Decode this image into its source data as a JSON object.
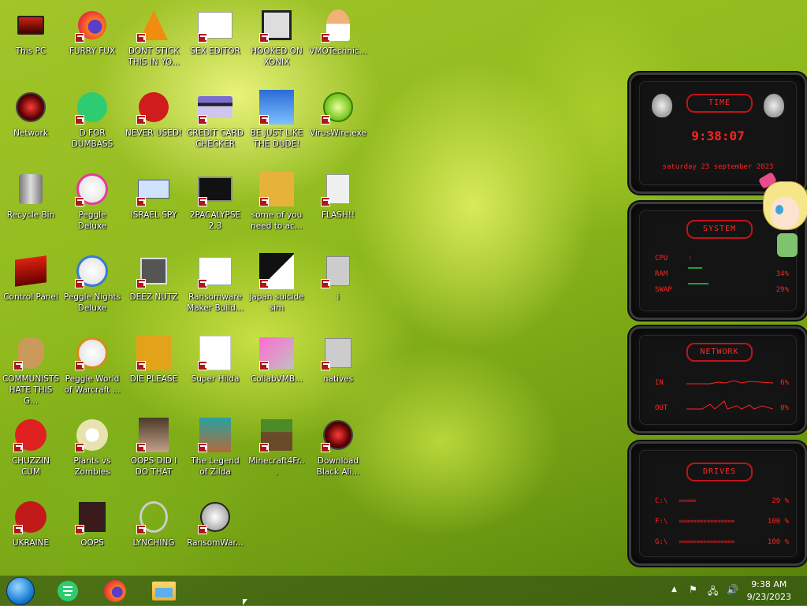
{
  "desktop_icons": [
    {
      "label": "This PC",
      "icon": "monitor-icon"
    },
    {
      "label": "FURRY FUX",
      "icon": "firefox-icon"
    },
    {
      "label": "DONT STICK THIS IN YO...",
      "icon": "vlc-cone-icon"
    },
    {
      "label": "SEX EDITOR",
      "icon": "hex-editor-icon"
    },
    {
      "label": "HOOKED ON XONIX",
      "icon": "xonix-icon"
    },
    {
      "label": "VMOTechnic...",
      "icon": "doctor-icon"
    },
    {
      "label": "Network",
      "icon": "red-orb-icon"
    },
    {
      "label": "D FOR DUMBASS",
      "icon": "green-chat-icon"
    },
    {
      "label": "NEVER USED!",
      "icon": "devcpp-icon"
    },
    {
      "label": "CREDIT CARD CHECKER",
      "icon": "credit-card-icon"
    },
    {
      "label": "BE JUST LIKE THE DUDE!",
      "icon": "santa-icon"
    },
    {
      "label": "VirusWire.exe",
      "icon": "lime-icon"
    },
    {
      "label": "Recycle Bin",
      "icon": "recycle-bin-icon"
    },
    {
      "label": "Peggle Deluxe",
      "icon": "peggle-icon"
    },
    {
      "label": "ISRAEL SPY",
      "icon": "network-spy-icon"
    },
    {
      "label": "2PACALYPSE 2.3",
      "icon": "terminal-icon"
    },
    {
      "label": "some of you need to ac...",
      "icon": "dog-icon"
    },
    {
      "label": "FLASH!!",
      "icon": "flash-icon"
    },
    {
      "label": "Control Panel",
      "icon": "control-panel-icon"
    },
    {
      "label": "Peggle Nights Deluxe",
      "icon": "peggle-nights-icon"
    },
    {
      "label": "DEEZ NUTZ",
      "icon": "stack-windows-icon"
    },
    {
      "label": "Ransomware Maker Build...",
      "icon": "ransomware-maker-icon"
    },
    {
      "label": "japan suicide sim",
      "icon": "japan-sim-icon"
    },
    {
      "label": "i",
      "icon": "app-i-icon"
    },
    {
      "label": "COMMUNISTS HATE THIS G...",
      "icon": "money-bag-icon"
    },
    {
      "label": "Peggle World of Warcraft ...",
      "icon": "peggle-wow-icon"
    },
    {
      "label": "DIE PLEASE",
      "icon": "de-icon"
    },
    {
      "label": "Super Hilda",
      "icon": "pixel-cat-icon"
    },
    {
      "label": "CollabVMB...",
      "icon": "collabvm-icon"
    },
    {
      "label": "natives",
      "icon": "natives-icon"
    },
    {
      "label": "CHUZZIN CUM",
      "icon": "chuzzle-icon"
    },
    {
      "label": "Plants vs Zombies",
      "icon": "pvz-icon"
    },
    {
      "label": "OOPS DID I DO THAT",
      "icon": "portrait-icon"
    },
    {
      "label": "The Legend of Zilda",
      "icon": "zilda-icon"
    },
    {
      "label": "Minecraft4Fr...",
      "icon": "minecraft-icon"
    },
    {
      "label": "Download Black Ali...",
      "icon": "red-orb-icon"
    },
    {
      "label": "UKRAINE",
      "icon": "radiation-icon"
    },
    {
      "label": "OOPS",
      "icon": "oops-icon"
    },
    {
      "label": "LYNCHING",
      "icon": "noose-icon"
    },
    {
      "label": "RansomWar...",
      "icon": "skull-icon"
    }
  ],
  "widget": {
    "time_title": "TIME",
    "time": "9:38:07",
    "date": "saturday 23 september 2023",
    "system_title": "SYSTEM",
    "cpu_label": "CPU",
    "ram_label": "RAM",
    "ram_pct": "34%",
    "swap_label": "SWAP",
    "swap_pct": "29%",
    "network_title": "NETWORK",
    "in_label": "IN",
    "in_pct": "6%",
    "out_label": "OUT",
    "out_pct": "0%",
    "drives_title": "DRIVES",
    "drives": [
      {
        "label": "C:\\",
        "pct": "29 %",
        "fill": 0.29
      },
      {
        "label": "F:\\",
        "pct": "100 %",
        "fill": 1.0
      },
      {
        "label": "G:\\",
        "pct": "100 %",
        "fill": 1.0
      }
    ]
  },
  "taskbar": {
    "time": "9:38 AM",
    "date": "9/23/2023"
  },
  "colors": {
    "accent_red": "#ff2323",
    "widget_bg": "#141414",
    "meter_green": "#1ea03a"
  }
}
